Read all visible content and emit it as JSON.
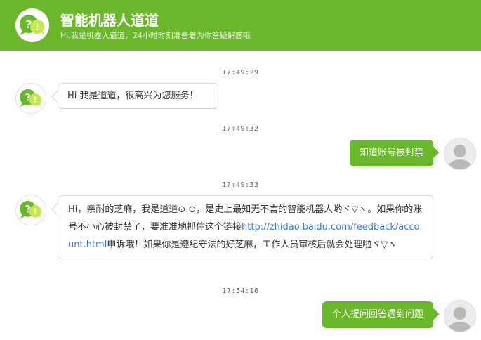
{
  "header": {
    "logo_icon": "robot-speech-bubbles-icon",
    "title": "智能机器人道道",
    "subtitle": "Hi,我是机器人道道，24小时时刻准备着为你答疑解惑哦",
    "color": "#6ab72b"
  },
  "messages": [
    {
      "time": "17:49:29",
      "sender": "bot",
      "text": "Hi 我是道道，很高兴为您服务！"
    },
    {
      "time": "17:49:32",
      "sender": "user",
      "text": "知道账号被封禁"
    },
    {
      "time": "17:49:33",
      "sender": "bot",
      "text_before_link": "Hi，亲耐的芝麻，我是道道⊙.⊙，是史上最知无不言的智能机器人哟ヾ▽ヽ。如果你的账号不小心被封禁了，要准准地抓住这个链接",
      "link": "http://zhidao.baidu.com/feedback/account.html",
      "text_after_link": "申诉哦！如果你是遵纪守法的好芝麻，工作人员审核后就会处理啦ヾ▽ヽ"
    },
    {
      "time": "17:54:16",
      "sender": "user",
      "text": "个人提问回答遇到问题"
    }
  ],
  "icons": {
    "bot_avatar": "robot-avatar-icon",
    "user_avatar": "default-user-avatar-icon"
  },
  "colors": {
    "accent": "#6ab72b",
    "link": "#3b7dd8",
    "bubble_border": "#d6d6d6"
  }
}
